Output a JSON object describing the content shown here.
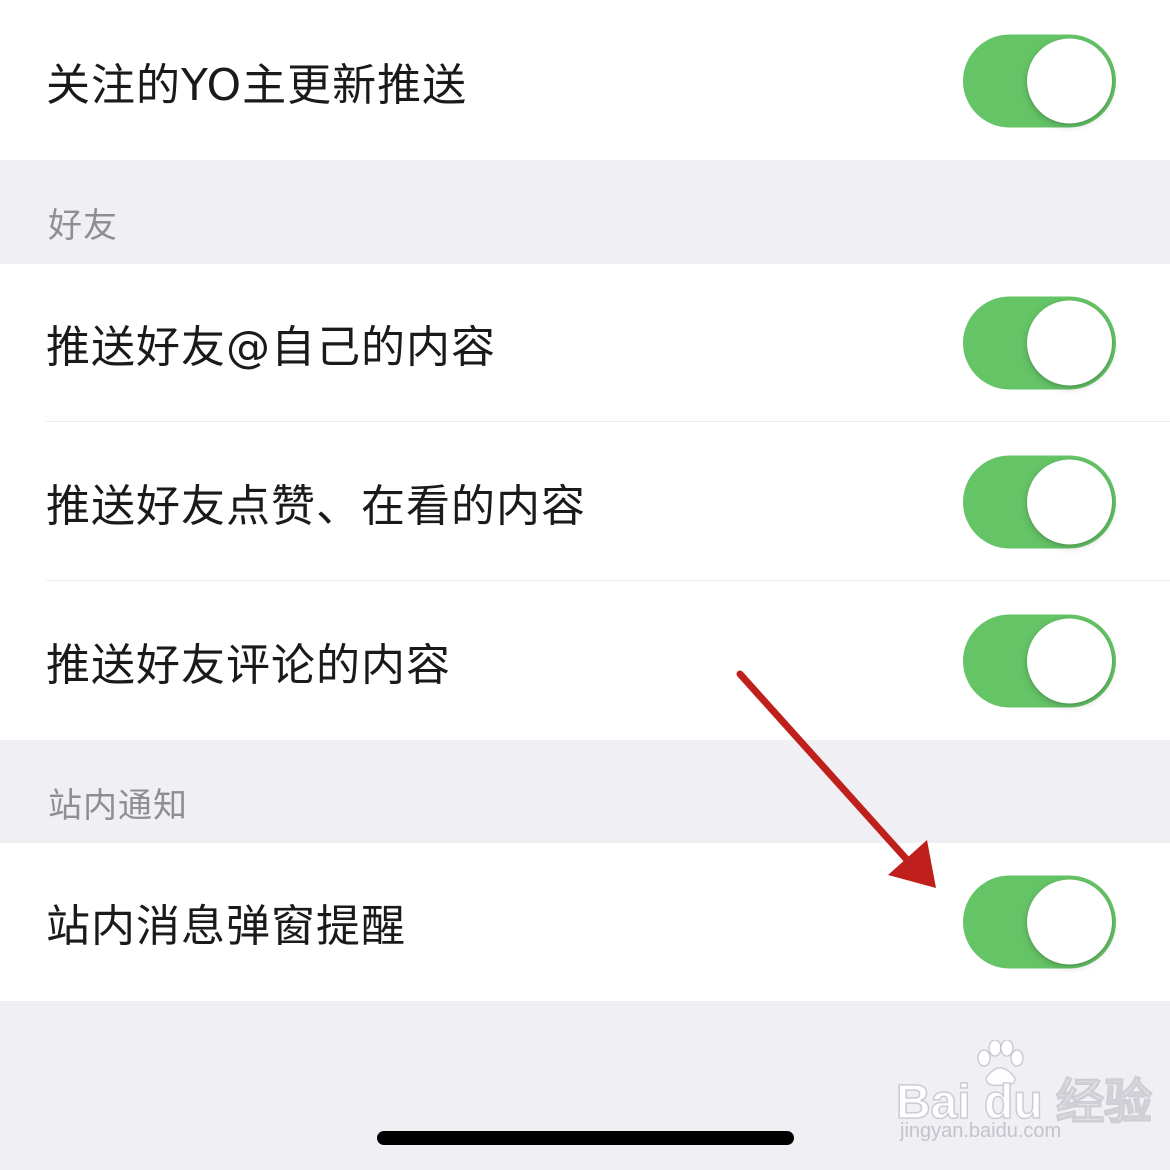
{
  "top_group": {
    "rows": [
      {
        "label": "关注的YO主更新推送",
        "toggle_on": true
      }
    ]
  },
  "friends_section": {
    "header": "好友",
    "rows": [
      {
        "label": "推送好友@自己的内容",
        "toggle_on": true
      },
      {
        "label": "推送好友点赞、在看的内容",
        "toggle_on": true
      },
      {
        "label": "推送好友评论的内容",
        "toggle_on": true
      }
    ]
  },
  "site_section": {
    "header": "站内通知",
    "rows": [
      {
        "label": "站内消息弹窗提醒",
        "toggle_on": true
      }
    ]
  },
  "watermark": {
    "brand": "Bai du 经验",
    "url": "jingyan.baidu.com"
  },
  "colors": {
    "toggle_on": "#65c466",
    "background": "#efeff4",
    "annotation_arrow": "#c0201c"
  },
  "icons": {
    "annotation": "red-arrow",
    "watermark": "paw-print-icon"
  }
}
